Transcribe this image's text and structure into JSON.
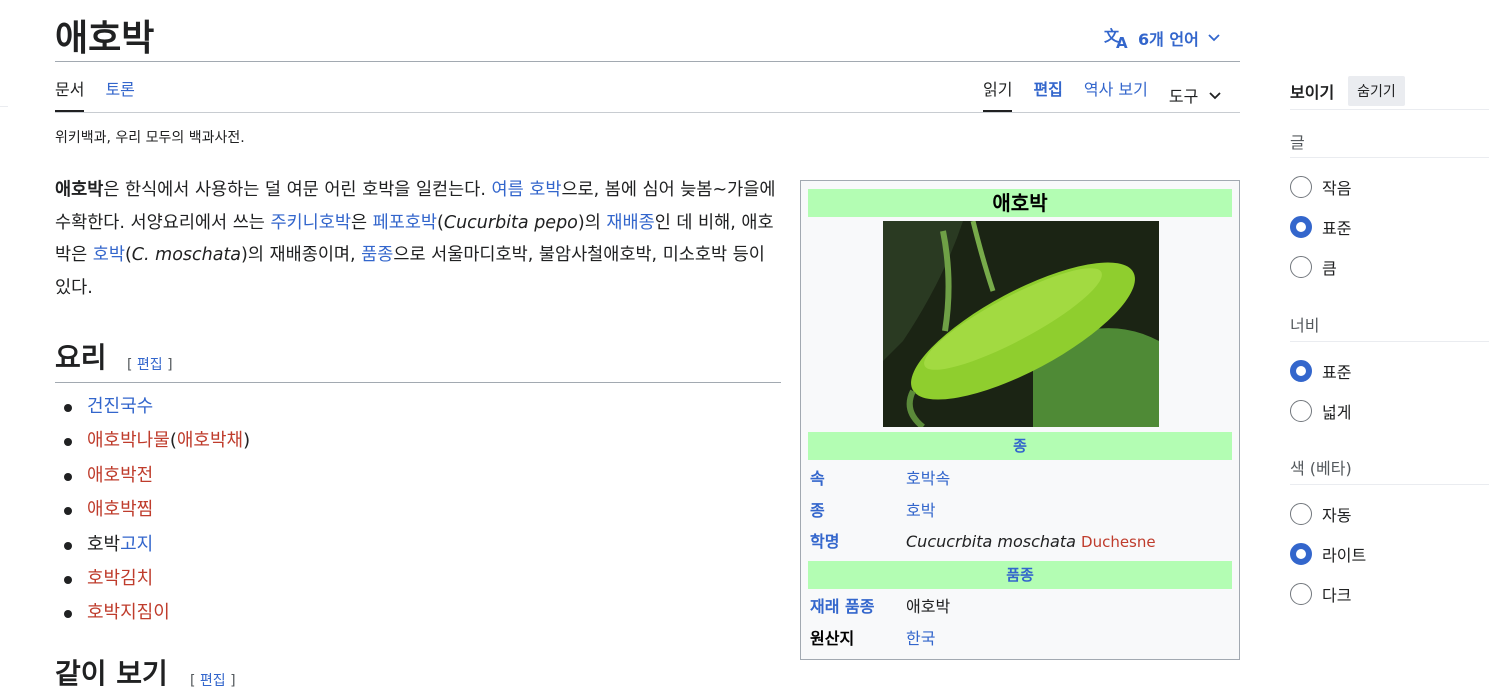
{
  "page": {
    "title": "애호박",
    "languages_label": "6개 언어",
    "tagline": "위키백과, 우리 모두의 백과사전."
  },
  "tabs": {
    "left": [
      "문서",
      "토론"
    ],
    "right": [
      "읽기",
      "편집",
      "역사 보기"
    ],
    "tools": "도구"
  },
  "lead": {
    "bold": "애호박",
    "t1": "은 한식에서 사용하는 덜 여문 어린 호박을 일컫는다. ",
    "l1": "여름 호박",
    "t2": "으로, 봄에 심어 늦봄~가을에 수확한다. 서양요리에서 쓰는 ",
    "l2": "주키니호박",
    "t3": "은 ",
    "l3": "페포호박",
    "t4": "(",
    "i1": "Cucurbita pepo",
    "t5": ")의 ",
    "l4": "재배종",
    "t6": "인 데 비해, 애호박은 ",
    "l5": "호박",
    "t7": "(",
    "i2": "C. moschata",
    "t8": ")의 재배종이며, ",
    "l6": "품종",
    "t9": "으로 서울마디호박, 불암사철애호박, 미소호박 등이 있다."
  },
  "sections": {
    "cooking": "요리",
    "see_also": "같이 보기",
    "edit_open": "[ ",
    "edit": "편집",
    "edit_close": " ]"
  },
  "cooking_list": {
    "i0": "건진국수",
    "i1a": "애호박나물",
    "i1b": "(",
    "i1c": "애호박채",
    "i1d": ")",
    "i2": "애호박전",
    "i3": "애호박찜",
    "i4a": "호박",
    "i4b": "고지",
    "i5": "호박김치",
    "i6": "호박지짐이"
  },
  "infobox": {
    "title": "애호박",
    "species_header": "종",
    "genus_key": "속",
    "genus_val": "호박속",
    "species_key": "종",
    "species_val": "호박",
    "sci_key": "학명",
    "sci_val": "Cucucrbita moschata",
    "sci_author": "Duchesne",
    "cultivar_header": "품종",
    "cultivar_key": "재래 품종",
    "cultivar_val": "애호박",
    "origin_key": "원산지",
    "origin_val": "한국"
  },
  "sidebar": {
    "title": "보이기",
    "hide": "숨기기",
    "text_label": "글",
    "text_options": [
      "작음",
      "표준",
      "큼"
    ],
    "width_label": "너비",
    "width_options": [
      "표준",
      "넓게"
    ],
    "color_label": "색 (베타)",
    "color_options": [
      "자동",
      "라이트",
      "다크"
    ]
  },
  "colors": {
    "link": "#3366cc",
    "redlink": "#bf3c2c",
    "infobox_header": "#b3fdb3"
  }
}
